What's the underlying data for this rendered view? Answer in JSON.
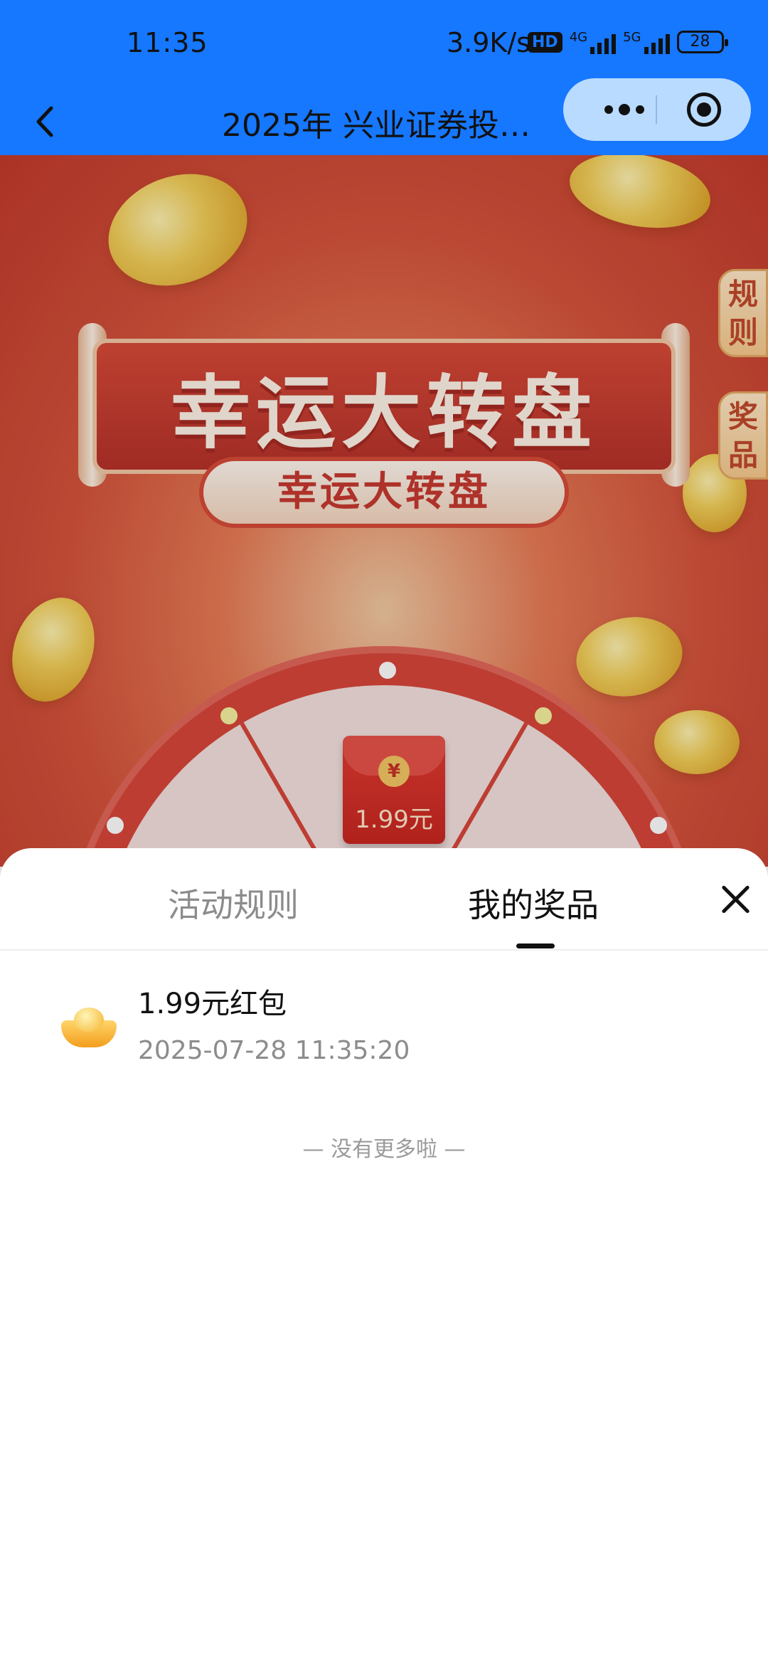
{
  "status_bar": {
    "time": "11:35",
    "net_speed": "3.9K/s",
    "hd_badge": "HD",
    "net_4g": "4G",
    "net_5g": "5G",
    "battery": "28"
  },
  "nav": {
    "title": "2025年 兴业证券投…"
  },
  "hero": {
    "banner_title": "幸运大转盘",
    "banner_subtitle": "幸运大转盘",
    "side_tab_rules": "规则",
    "side_tab_prizes": "奖品",
    "wheel_prize_amount": "1.99元",
    "wheel_prize_symbol": "¥"
  },
  "sheet": {
    "tab_rules": "活动规则",
    "tab_prizes": "我的奖品",
    "prizes": [
      {
        "name": "1.99元红包",
        "time": "2025-07-28 11:35:20"
      }
    ],
    "no_more": "— 没有更多啦 —"
  },
  "colors": {
    "nav_bg": "#1677ff",
    "accent_red": "#d8463a"
  }
}
